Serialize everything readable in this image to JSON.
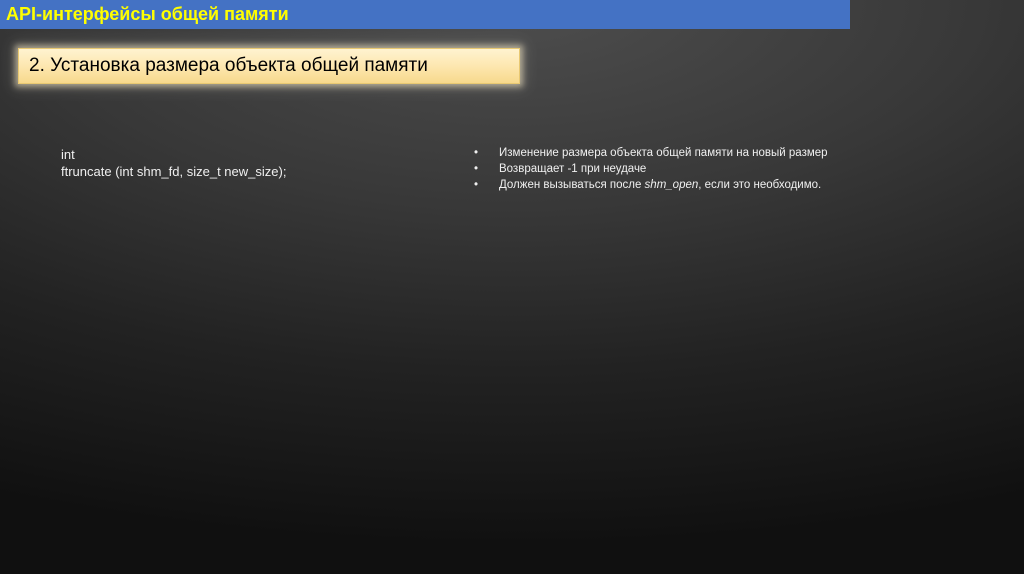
{
  "slide": {
    "title": "API-интерфейсы общей памяти",
    "subtitle": "2. Установка размера объекта общей памяти",
    "code_lines": [
      "int",
      "ftruncate (int shm_fd, size_t new_size);"
    ],
    "bullet_symbol": "•",
    "bullets": [
      {
        "text": "Изменение размера объекта общей памяти на новый размер"
      },
      {
        "text": "Возвращает -1 при неудаче"
      },
      {
        "before": "Должен вызываться после ",
        "emphasis": "shm_open",
        "after": ", если это необходимо."
      }
    ]
  },
  "colors": {
    "title_bar": "#4472c4",
    "title_text": "#ffff00",
    "subtitle_bg": "#fde7b0",
    "body_text": "#f0f0f0"
  }
}
